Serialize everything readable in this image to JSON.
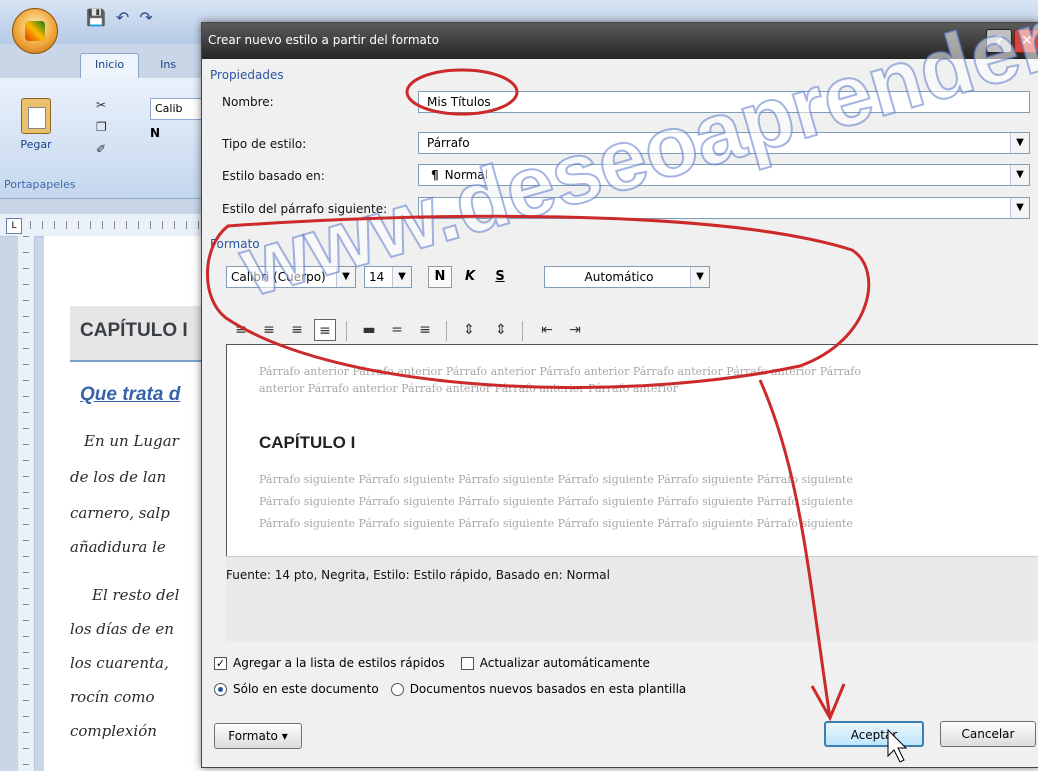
{
  "word": {
    "tabs": [
      "Inicio",
      "Ins"
    ],
    "font_stub": "Calib",
    "paste_label": "Pegar",
    "clipboard_group": "Portapapeles",
    "format_stub": "N"
  },
  "document": {
    "heading": "CAPÍTULO I",
    "subheading": "Que trata d",
    "lines": [
      "En un Lugar",
      "de los de lan",
      "carnero, salp",
      "añadidura le",
      "El resto del",
      "los días de en",
      "los cuarenta,",
      "rocín como",
      "complexión"
    ]
  },
  "dialog": {
    "title": "Crear nuevo estilo a partir del formato",
    "help": "?",
    "close": "✕",
    "properties_section": "Propiedades",
    "name_label": "Nombre:",
    "name_value": "Mis Títulos",
    "style_type_label": "Tipo de estilo:",
    "style_type_value": "Párrafo",
    "based_on_label": "Estilo basado en:",
    "based_on_value": "Normal",
    "next_style_label": "Estilo del párrafo siguiente:",
    "next_style_value": "",
    "format_section": "Formato",
    "font_value": "Calibri (Cuerpo)",
    "size_value": "14",
    "bold": "N",
    "italic": "K",
    "underline": "S",
    "color_value": "Automático",
    "preview": {
      "prev_lines": [
        "Párrafo anterior Párrafo anterior Párrafo anterior Párrafo anterior Párrafo anterior Párrafo anterior Párrafo",
        "anterior Párrafo anterior Párrafo anterior Párrafo anterior Párrafo anterior"
      ],
      "heading": "CAPÍTULO I",
      "next_lines": [
        "Párrafo siguiente Párrafo siguiente Párrafo siguiente Párrafo siguiente Párrafo siguiente Párrafo siguiente",
        "Párrafo siguiente Párrafo siguiente Párrafo siguiente Párrafo siguiente Párrafo siguiente Párrafo siguiente",
        "Párrafo siguiente Párrafo siguiente Párrafo siguiente Párrafo siguiente Párrafo siguiente Párrafo siguiente"
      ]
    },
    "description": "Fuente: 14 pto, Negrita, Estilo: Estilo rápido, Basado en: Normal",
    "add_quick_styles": "Agregar a la lista de estilos rápidos",
    "auto_update": "Actualizar automáticamente",
    "only_this_doc": "Sólo en este documento",
    "new_docs_template": "Documentos nuevos basados en esta plantilla",
    "format_button": "Formato",
    "accept_button": "Aceptar",
    "cancel_button": "Cancelar"
  },
  "watermark": "www.deseoaprender.com",
  "colors": {
    "annotation": "#cc2a2a",
    "accent": "#2a55a0"
  }
}
